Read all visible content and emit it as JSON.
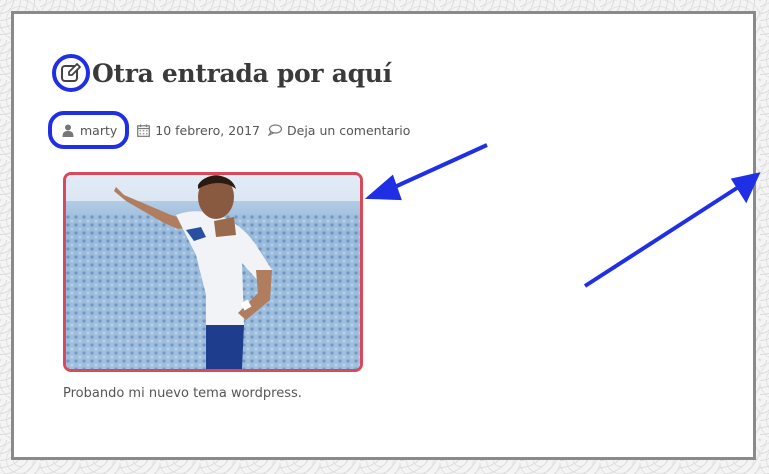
{
  "post": {
    "title": "Otra entrada por aquí",
    "author": "marty",
    "date": "10 febrero, 2017",
    "comments_link": "Deja un comentario",
    "excerpt": "Probando mi nuevo tema wordpress."
  },
  "icons": {
    "title": "edit-icon",
    "author": "user-icon",
    "date": "calendar-icon",
    "comments": "comment-icon"
  },
  "colors": {
    "annotation_blue": "#1f2fe6",
    "image_border": "#d84a5a",
    "title_text": "#3a3a3a"
  }
}
